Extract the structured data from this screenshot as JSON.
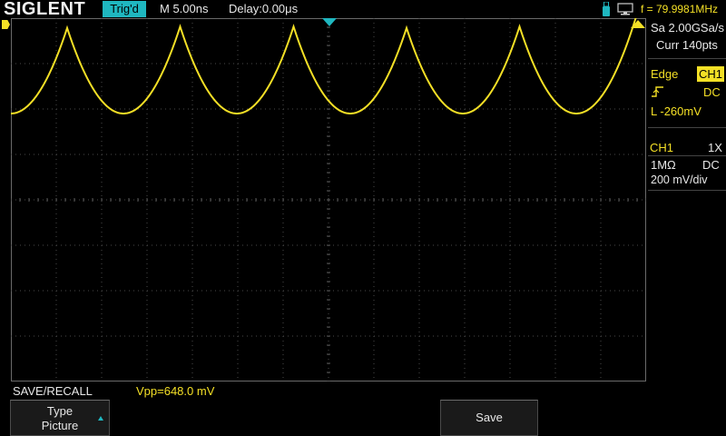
{
  "header": {
    "brand": "SIGLENT",
    "trigger_status": "Trig'd",
    "timebase": "M 5.00ns",
    "delay": "Delay:0.00μs",
    "frequency": "f = 79.9981MHz",
    "icons": [
      "usb-icon",
      "monitor-icon"
    ]
  },
  "acquisition": {
    "sample_rate": "Sa 2.00GSa/s",
    "memory_depth": "Curr 140pts"
  },
  "trigger": {
    "type": "Edge",
    "source": "CH1",
    "coupling": "DC",
    "level": "L  -260mV",
    "slope_icon": "rising-edge-icon"
  },
  "channel": {
    "name": "CH1",
    "probe": "1X",
    "impedance": "1MΩ",
    "coupling": "DC",
    "scale": "200 mV/div"
  },
  "measurement": {
    "vpp": "Vpp=648.0 mV"
  },
  "menu": {
    "title": "SAVE/RECALL",
    "type_label": "Type",
    "type_value": "Picture",
    "save_label": "Save"
  },
  "colors": {
    "ch1": "#f4e026",
    "accent": "#1fb7c0",
    "background": "#000000",
    "grid": "#5a5a5a"
  }
}
